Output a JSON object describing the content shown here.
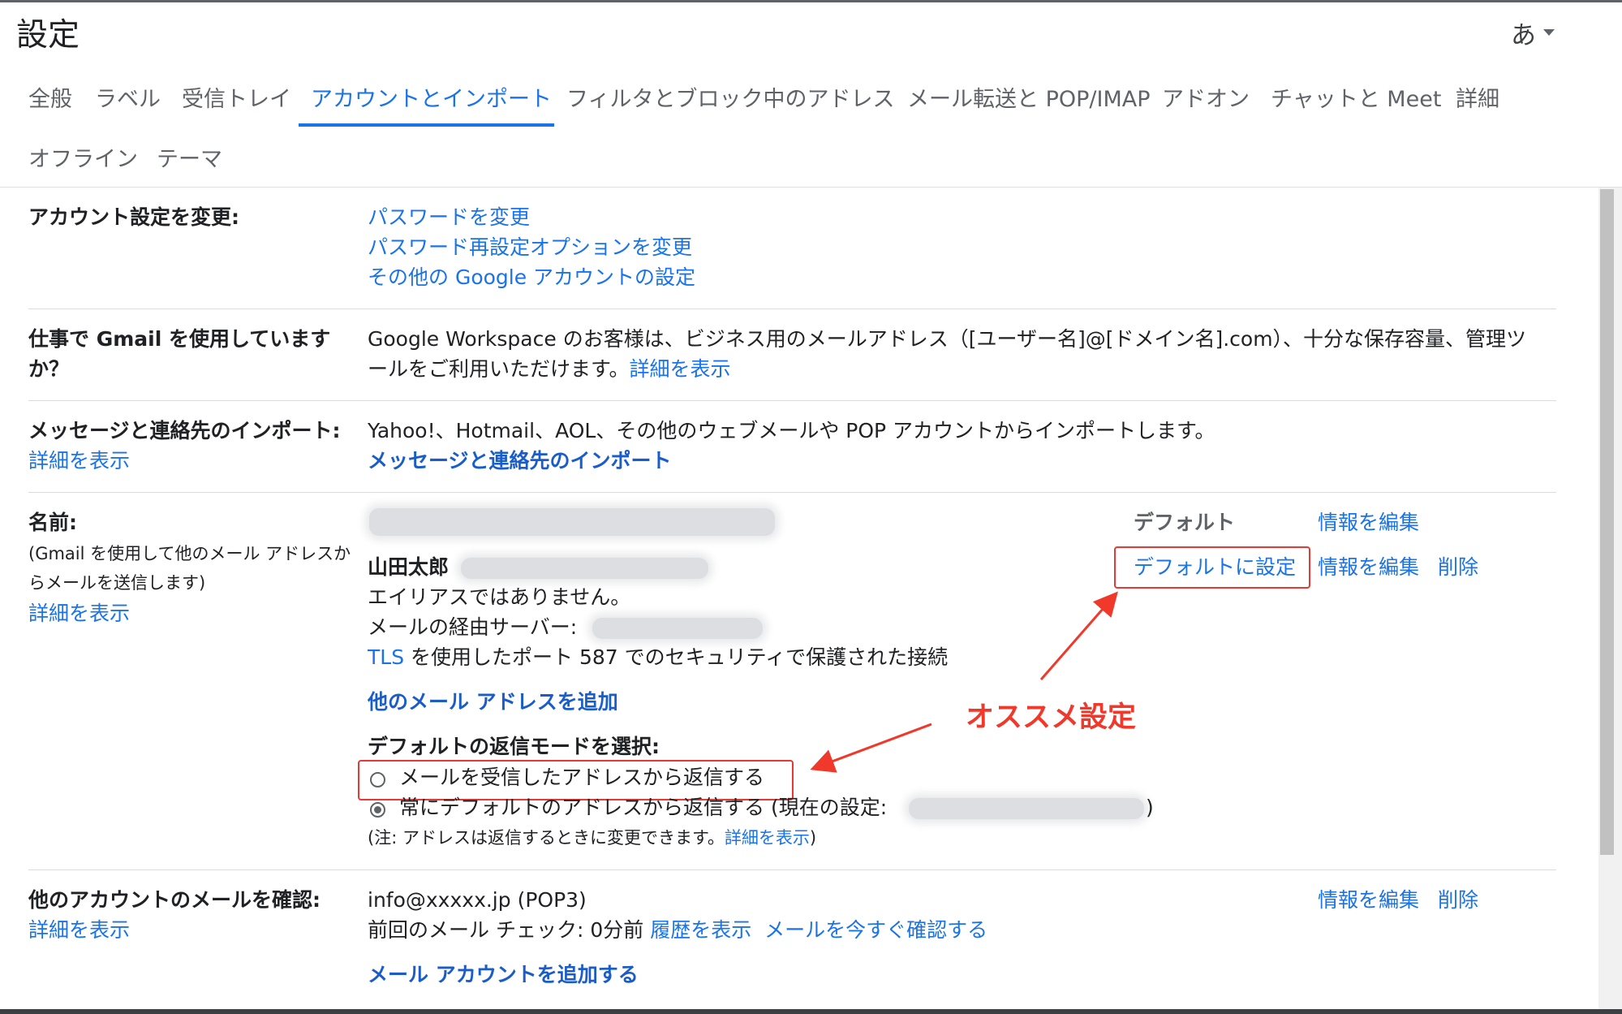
{
  "header": {
    "title": "設定",
    "lang_label": "あ"
  },
  "tabs": [
    {
      "label": "全般"
    },
    {
      "label": "ラベル"
    },
    {
      "label": "受信トレイ"
    },
    {
      "label": "アカウントとインポート"
    },
    {
      "label": "フィルタとブロック中のアドレス"
    },
    {
      "label": "メール転送と POP/IMAP"
    },
    {
      "label": "アドオン"
    },
    {
      "label": "チャットと Meet"
    },
    {
      "label": "詳細"
    },
    {
      "label": "オフライン"
    },
    {
      "label": "テーマ"
    }
  ],
  "active_tab": "アカウントとインポート",
  "sections": {
    "account": {
      "label": "アカウント設定を変更:",
      "links": [
        "パスワードを変更",
        "パスワード再設定オプションを変更",
        "その他の Google アカウントの設定"
      ]
    },
    "workspace": {
      "label_line1": "仕事で Gmail を使用していますか？",
      "label_line2": "か？",
      "label_line1_short": "仕事で Gmail を使用しています",
      "text_line1": "Google Workspace のお客様は、ビジネス用のメールアドレス（[ユーザー名]@[ドメイン名].com）、十分な保存容量、管理ツ",
      "text_line2": "ールをご利用いただけます。",
      "link": "詳細を表示"
    },
    "import": {
      "label": "メッセージと連絡先のインポート:",
      "learn_more": "詳細を表示",
      "text": "Yahoo!、Hotmail、AOL、その他のウェブメールや POP アカウントからインポートします。",
      "link": "メッセージと連絡先のインポート"
    },
    "sendas": {
      "label": "名前:",
      "desc_line1": "(Gmail を使用して他のメール アドレスか",
      "desc_line2": "らメールを送信します)",
      "learn_more": "詳細を表示",
      "default_header": "デフォルト",
      "edit_info": "情報を編集",
      "name": "山田太郎",
      "no_alias": "エイリアスではありません。",
      "via_server": "メールの経由サーバー:",
      "tls_link": "TLS",
      "tls_text": " を使用したポート 587 でのセキュリティで保護された接続",
      "make_default": "デフォルトに設定",
      "delete": "削除",
      "add_address": "他のメール アドレスを追加",
      "reply_mode_label": "デフォルトの返信モードを選択:",
      "reply_option_1": "メールを受信したアドレスから返信する",
      "reply_option_2_prefix": "常にデフォルトのアドレスから返信する (現在の設定:",
      "reply_option_2_suffix": ")",
      "reply_selected": 2,
      "note_prefix": "(注: アドレスは返信するときに変更できます。",
      "note_link": "詳細を表示",
      "note_suffix": ")"
    },
    "checkmail": {
      "label": "他のアカウントのメールを確認:",
      "learn_more": "詳細を表示",
      "account": "info@xxxxx.jp (POP3)",
      "last_check": "前回のメール チェック: 0分前",
      "history_link": "履歴を表示",
      "check_now_link": "メールを今すぐ確認する",
      "edit_info": "情報を編集",
      "delete": "削除",
      "add_account": "メール アカウントを追加する"
    }
  },
  "annotation": {
    "text": "オススメ設定",
    "color": "#f0392b"
  },
  "colors": {
    "link": "#1a73e8",
    "active_tab": "#1a73e8",
    "highlight_box": "#e53935"
  }
}
